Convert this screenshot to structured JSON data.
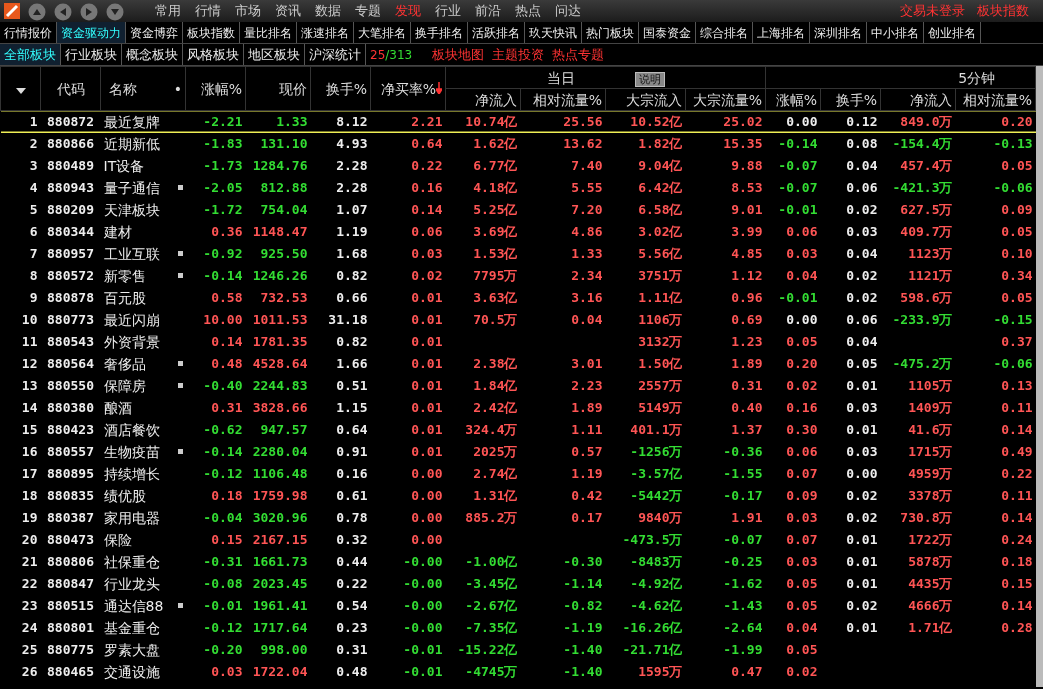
{
  "menu": [
    {
      "label": "常用",
      "selected": false
    },
    {
      "label": "行情",
      "selected": false
    },
    {
      "label": "市场",
      "selected": false
    },
    {
      "label": "资讯",
      "selected": false
    },
    {
      "label": "数据",
      "selected": false
    },
    {
      "label": "专题",
      "selected": false
    },
    {
      "label": "发现",
      "selected": true
    },
    {
      "label": "行业",
      "selected": false
    },
    {
      "label": "前沿",
      "selected": false
    },
    {
      "label": "热点",
      "selected": false
    },
    {
      "label": "问达",
      "selected": false
    }
  ],
  "status_links": [
    "交易未登录",
    "板块指数"
  ],
  "tabs": [
    {
      "label": "行情报价",
      "selected": false
    },
    {
      "label": "资金驱动力",
      "selected": true
    },
    {
      "label": "资金博弈",
      "selected": false
    },
    {
      "label": "板块指数",
      "selected": false
    },
    {
      "label": "量比排名",
      "selected": false
    },
    {
      "label": "涨速排名",
      "selected": false
    },
    {
      "label": "大笔排名",
      "selected": false
    },
    {
      "label": "换手排名",
      "selected": false
    },
    {
      "label": "活跃排名",
      "selected": false
    },
    {
      "label": "玖天快讯",
      "selected": false
    },
    {
      "label": "热门板块",
      "selected": false
    },
    {
      "label": "国泰资金",
      "selected": false
    },
    {
      "label": "综合排名",
      "selected": false
    },
    {
      "label": "上海排名",
      "selected": false
    },
    {
      "label": "深圳排名",
      "selected": false
    },
    {
      "label": "中小排名",
      "selected": false
    },
    {
      "label": "创业排名",
      "selected": false
    }
  ],
  "sector_tabs": [
    {
      "label": "全部板块",
      "selected": true
    },
    {
      "label": "行业板块",
      "selected": false
    },
    {
      "label": "概念板块",
      "selected": false
    },
    {
      "label": "风格板块",
      "selected": false
    },
    {
      "label": "地区板块",
      "selected": false
    },
    {
      "label": "沪深统计",
      "selected": false
    }
  ],
  "page_counter": {
    "current": "25",
    "total": "/313"
  },
  "quick_links": [
    "板块地图",
    "主题投资",
    "热点专题"
  ],
  "table": {
    "fixed_columns": [
      {
        "label": "代码"
      },
      {
        "label": "名称",
        "marker": "•"
      },
      {
        "label": "涨幅%",
        "kind": "change",
        "sorted": false
      },
      {
        "label": "现价",
        "kind": "follow",
        "sorted": false
      },
      {
        "label": "换手%",
        "kind": "plain",
        "sorted": false
      },
      {
        "label": "净买率%",
        "kind": "signed",
        "sorted": true
      }
    ],
    "groups": [
      {
        "label": "当日",
        "button": "说明",
        "columns": [
          {
            "label": "净流入",
            "kind": "signed"
          },
          {
            "label": "相对流量%",
            "kind": "signed"
          },
          {
            "label": "大宗流入",
            "kind": "signed"
          },
          {
            "label": "大宗流量%",
            "kind": "signed"
          }
        ]
      },
      {
        "label": "5分钟",
        "columns": [
          {
            "label": "涨幅%",
            "kind": "change"
          },
          {
            "label": "换手%",
            "kind": "plain"
          },
          {
            "label": "净流入",
            "kind": "signed"
          },
          {
            "label": "相对流量%",
            "kind": "signed"
          }
        ]
      }
    ],
    "rows": [
      {
        "index": "1",
        "code": "880872",
        "name": "最近复牌",
        "flag": false,
        "selected": true,
        "cells": [
          "-2.21",
          "1.33",
          "8.12",
          "2.21",
          "10.74亿",
          "25.56",
          "10.52亿",
          "25.02",
          "0.00",
          "0.12",
          "849.0万",
          "0.20"
        ]
      },
      {
        "index": "2",
        "code": "880866",
        "name": "近期新低",
        "flag": false,
        "selected": false,
        "cells": [
          "-1.83",
          "131.10",
          "4.93",
          "0.64",
          "1.62亿",
          "13.62",
          "1.82亿",
          "15.35",
          "-0.14",
          "0.08",
          "-154.4万",
          "-0.13"
        ]
      },
      {
        "index": "3",
        "code": "880489",
        "name": "IT设备",
        "flag": false,
        "selected": false,
        "cells": [
          "-1.73",
          "1284.76",
          "2.28",
          "0.22",
          "6.77亿",
          "7.40",
          "9.04亿",
          "9.88",
          "-0.07",
          "0.04",
          "457.4万",
          "0.05"
        ]
      },
      {
        "index": "4",
        "code": "880943",
        "name": "量子通信",
        "flag": true,
        "selected": false,
        "cells": [
          "-2.05",
          "812.88",
          "2.28",
          "0.16",
          "4.18亿",
          "5.55",
          "6.42亿",
          "8.53",
          "-0.07",
          "0.06",
          "-421.3万",
          "-0.06"
        ]
      },
      {
        "index": "5",
        "code": "880209",
        "name": "天津板块",
        "flag": false,
        "selected": false,
        "cells": [
          "-1.72",
          "754.04",
          "1.07",
          "0.14",
          "5.25亿",
          "7.20",
          "6.58亿",
          "9.01",
          "-0.01",
          "0.02",
          "627.5万",
          "0.09"
        ]
      },
      {
        "index": "6",
        "code": "880344",
        "name": "建材",
        "flag": false,
        "selected": false,
        "cells": [
          "0.36",
          "1148.47",
          "1.19",
          "0.06",
          "3.69亿",
          "4.86",
          "3.02亿",
          "3.99",
          "0.06",
          "0.03",
          "409.7万",
          "0.05"
        ]
      },
      {
        "index": "7",
        "code": "880957",
        "name": "工业互联",
        "flag": true,
        "selected": false,
        "cells": [
          "-0.92",
          "925.50",
          "1.68",
          "0.03",
          "1.53亿",
          "1.33",
          "5.56亿",
          "4.85",
          "0.03",
          "0.04",
          "1123万",
          "0.10"
        ]
      },
      {
        "index": "8",
        "code": "880572",
        "name": "新零售",
        "flag": true,
        "selected": false,
        "cells": [
          "-0.14",
          "1246.26",
          "0.82",
          "0.02",
          "7795万",
          "2.34",
          "3751万",
          "1.12",
          "0.04",
          "0.02",
          "1121万",
          "0.34"
        ]
      },
      {
        "index": "9",
        "code": "880878",
        "name": "百元股",
        "flag": false,
        "selected": false,
        "cells": [
          "0.58",
          "732.53",
          "0.66",
          "0.01",
          "3.63亿",
          "3.16",
          "1.11亿",
          "0.96",
          "-0.01",
          "0.02",
          "598.6万",
          "0.05"
        ]
      },
      {
        "index": "10",
        "code": "880773",
        "name": "最近闪崩",
        "flag": false,
        "selected": false,
        "cells": [
          "10.00",
          "1011.53",
          "31.18",
          "0.01",
          "70.5万",
          "0.04",
          "1106万",
          "0.69",
          "0.00",
          "0.06",
          "-233.9万",
          "-0.15"
        ]
      },
      {
        "index": "11",
        "code": "880543",
        "name": "外资背景",
        "flag": false,
        "selected": false,
        "cells": [
          "0.14",
          "1781.35",
          "0.82",
          "0.01",
          null,
          null,
          "3132万",
          "1.23",
          "0.05",
          "0.04",
          null,
          "0.37"
        ]
      },
      {
        "index": "12",
        "code": "880564",
        "name": "奢侈品",
        "flag": true,
        "selected": false,
        "cells": [
          "0.48",
          "4528.64",
          "1.66",
          "0.01",
          "2.38亿",
          "3.01",
          "1.50亿",
          "1.89",
          "0.20",
          "0.05",
          "-475.2万",
          "-0.06"
        ]
      },
      {
        "index": "13",
        "code": "880550",
        "name": "保障房",
        "flag": true,
        "selected": false,
        "cells": [
          "-0.40",
          "2244.83",
          "0.51",
          "0.01",
          "1.84亿",
          "2.23",
          "2557万",
          "0.31",
          "0.02",
          "0.01",
          "1105万",
          "0.13"
        ]
      },
      {
        "index": "14",
        "code": "880380",
        "name": "酿酒",
        "flag": false,
        "selected": false,
        "cells": [
          "0.31",
          "3828.66",
          "1.15",
          "0.01",
          "2.42亿",
          "1.89",
          "5149万",
          "0.40",
          "0.16",
          "0.03",
          "1409万",
          "0.11"
        ]
      },
      {
        "index": "15",
        "code": "880423",
        "name": "酒店餐饮",
        "flag": false,
        "selected": false,
        "cells": [
          "-0.62",
          "947.57",
          "0.64",
          "0.01",
          "324.4万",
          "1.11",
          "401.1万",
          "1.37",
          "0.30",
          "0.01",
          "41.6万",
          "0.14"
        ]
      },
      {
        "index": "16",
        "code": "880557",
        "name": "生物疫苗",
        "flag": true,
        "selected": false,
        "cells": [
          "-0.14",
          "2280.04",
          "0.91",
          "0.01",
          "2025万",
          "0.57",
          "-1256万",
          "-0.36",
          "0.06",
          "0.03",
          "1715万",
          "0.49"
        ]
      },
      {
        "index": "17",
        "code": "880895",
        "name": "持续增长",
        "flag": false,
        "selected": false,
        "cells": [
          "-0.12",
          "1106.48",
          "0.16",
          "0.00",
          "2.74亿",
          "1.19",
          "-3.57亿",
          "-1.55",
          "0.07",
          "0.00",
          "4959万",
          "0.22"
        ]
      },
      {
        "index": "18",
        "code": "880835",
        "name": "绩优股",
        "flag": false,
        "selected": false,
        "cells": [
          "0.18",
          "1759.98",
          "0.61",
          "0.00",
          "1.31亿",
          "0.42",
          "-5442万",
          "-0.17",
          "0.09",
          "0.02",
          "3378万",
          "0.11"
        ]
      },
      {
        "index": "19",
        "code": "880387",
        "name": "家用电器",
        "flag": false,
        "selected": false,
        "cells": [
          "-0.04",
          "3020.96",
          "0.78",
          "0.00",
          "885.2万",
          "0.17",
          "9840万",
          "1.91",
          "0.03",
          "0.02",
          "730.8万",
          "0.14"
        ]
      },
      {
        "index": "20",
        "code": "880473",
        "name": "保险",
        "flag": false,
        "selected": false,
        "cells": [
          "0.15",
          "2167.15",
          "0.32",
          "0.00",
          null,
          null,
          "-473.5万",
          "-0.07",
          "0.07",
          "0.01",
          "1722万",
          "0.24"
        ]
      },
      {
        "index": "21",
        "code": "880806",
        "name": "社保重仓",
        "flag": false,
        "selected": false,
        "cells": [
          "-0.31",
          "1661.73",
          "0.44",
          "-0.00",
          "-1.00亿",
          "-0.30",
          "-8483万",
          "-0.25",
          "0.03",
          "0.01",
          "5878万",
          "0.18"
        ]
      },
      {
        "index": "22",
        "code": "880847",
        "name": "行业龙头",
        "flag": false,
        "selected": false,
        "cells": [
          "-0.08",
          "2023.45",
          "0.22",
          "-0.00",
          "-3.45亿",
          "-1.14",
          "-4.92亿",
          "-1.62",
          "0.05",
          "0.01",
          "4435万",
          "0.15"
        ]
      },
      {
        "index": "23",
        "code": "880515",
        "name": "通达信88",
        "flag": true,
        "selected": false,
        "cells": [
          "-0.01",
          "1961.41",
          "0.54",
          "-0.00",
          "-2.67亿",
          "-0.82",
          "-4.62亿",
          "-1.43",
          "0.05",
          "0.02",
          "4666万",
          "0.14"
        ]
      },
      {
        "index": "24",
        "code": "880801",
        "name": "基金重仓",
        "flag": false,
        "selected": false,
        "cells": [
          "-0.12",
          "1717.64",
          "0.23",
          "-0.00",
          "-7.35亿",
          "-1.19",
          "-16.26亿",
          "-2.64",
          "0.04",
          "0.01",
          "1.71亿",
          "0.28"
        ]
      },
      {
        "index": "25",
        "code": "880775",
        "name": "罗素大盘",
        "flag": false,
        "selected": false,
        "cells": [
          "-0.20",
          "998.00",
          "0.31",
          "-0.01",
          "-15.22亿",
          "-1.40",
          "-21.71亿",
          "-1.99",
          "0.05",
          null,
          null,
          null
        ]
      },
      {
        "index": "26",
        "code": "880465",
        "name": "交通设施",
        "flag": false,
        "selected": false,
        "cells": [
          "0.03",
          "1722.04",
          "0.48",
          "-0.01",
          "-4745万",
          "-1.40",
          "1595万",
          "0.47",
          "0.02",
          null,
          null,
          null
        ]
      }
    ]
  }
}
